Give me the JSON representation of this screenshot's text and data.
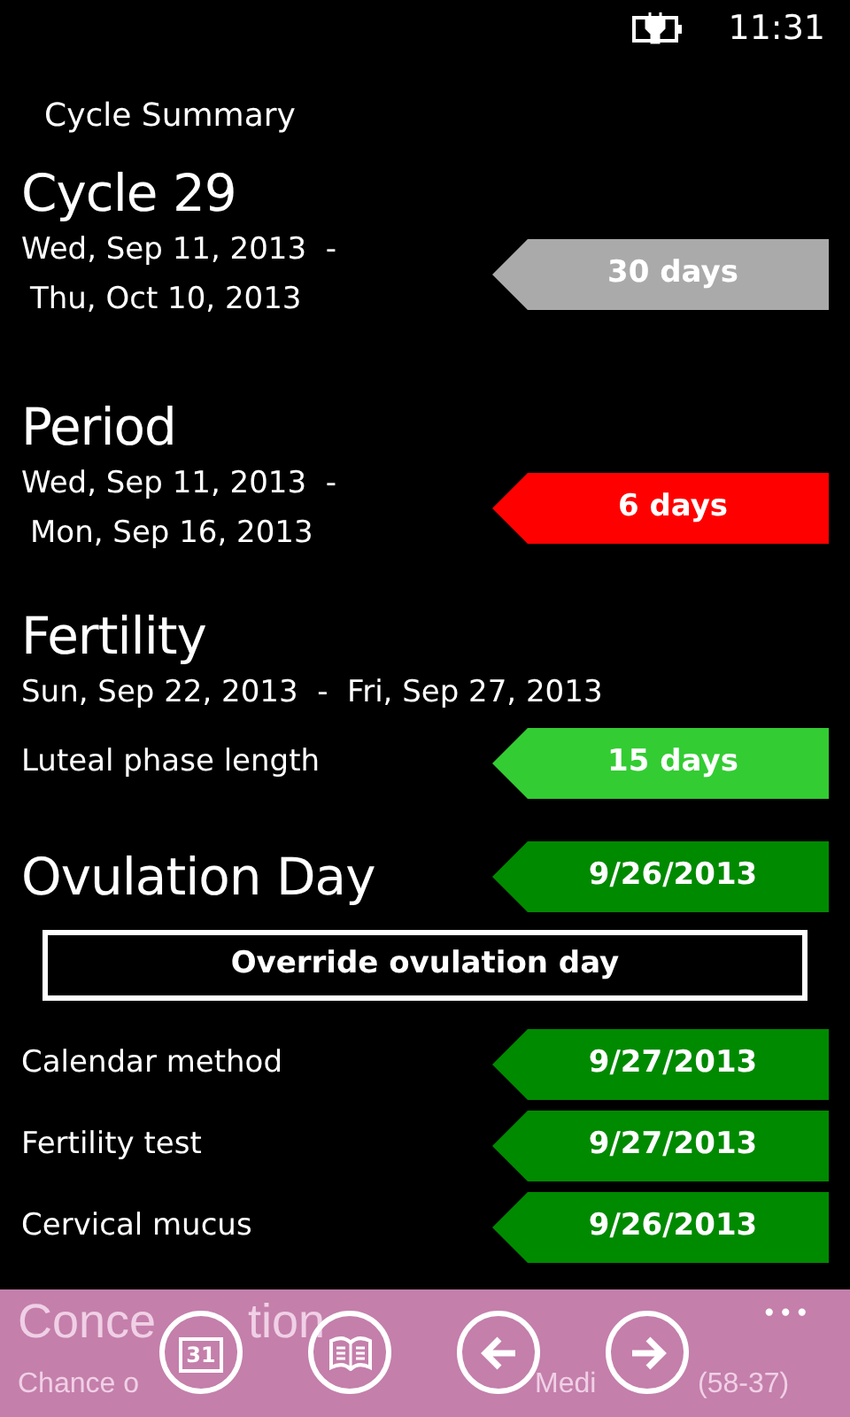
{
  "status_bar": {
    "time": "11:31"
  },
  "page_title": "Cycle Summary",
  "sections": [
    {
      "kind": "period",
      "title": "Cycle 29",
      "dates": [
        "Wed, Sep 11, 2013  -",
        "Thu, Oct 10, 2013"
      ],
      "tag": {
        "text": "30 days",
        "color": "#aaaaaa"
      }
    },
    {
      "kind": "period",
      "title": "Period",
      "dates": [
        "Wed, Sep 11, 2013  -",
        "Mon, Sep 16, 2013"
      ],
      "tag": {
        "text": "6 days",
        "color": "#ff0000"
      }
    },
    {
      "kind": "heading",
      "title": "Fertility"
    },
    {
      "kind": "line",
      "text": "Sun, Sep 22, 2013  -  Fri, Sep 27, 2013"
    },
    {
      "kind": "row",
      "label": "Luteal phase length",
      "tag": {
        "text": "15 days",
        "color": "#33cc33"
      }
    },
    {
      "kind": "heading-row",
      "title": "Ovulation Day",
      "tag": {
        "text": "9/26/2013",
        "color": "#008a00"
      }
    },
    {
      "kind": "button",
      "text": "Override ovulation day"
    },
    {
      "kind": "row",
      "label": "Calendar method",
      "tag": {
        "text": "9/27/2013",
        "color": "#008a00"
      }
    },
    {
      "kind": "row",
      "label": "Fertility test",
      "tag": {
        "text": "9/27/2013",
        "color": "#008a00"
      }
    },
    {
      "kind": "row",
      "label": "Cervical mucus",
      "tag": {
        "text": "9/26/2013",
        "color": "#008a00"
      }
    }
  ],
  "app_bar": {
    "under_title": [
      "Conce",
      "tion"
    ],
    "under_label": [
      "Chance o"
    ],
    "under_value": [
      "Medi",
      "(58-37)"
    ],
    "more": "•••",
    "buttons": [
      {
        "kind": "calendar",
        "text": "31"
      },
      {
        "kind": "book"
      },
      {
        "kind": "back"
      },
      {
        "kind": "forward"
      }
    ]
  }
}
